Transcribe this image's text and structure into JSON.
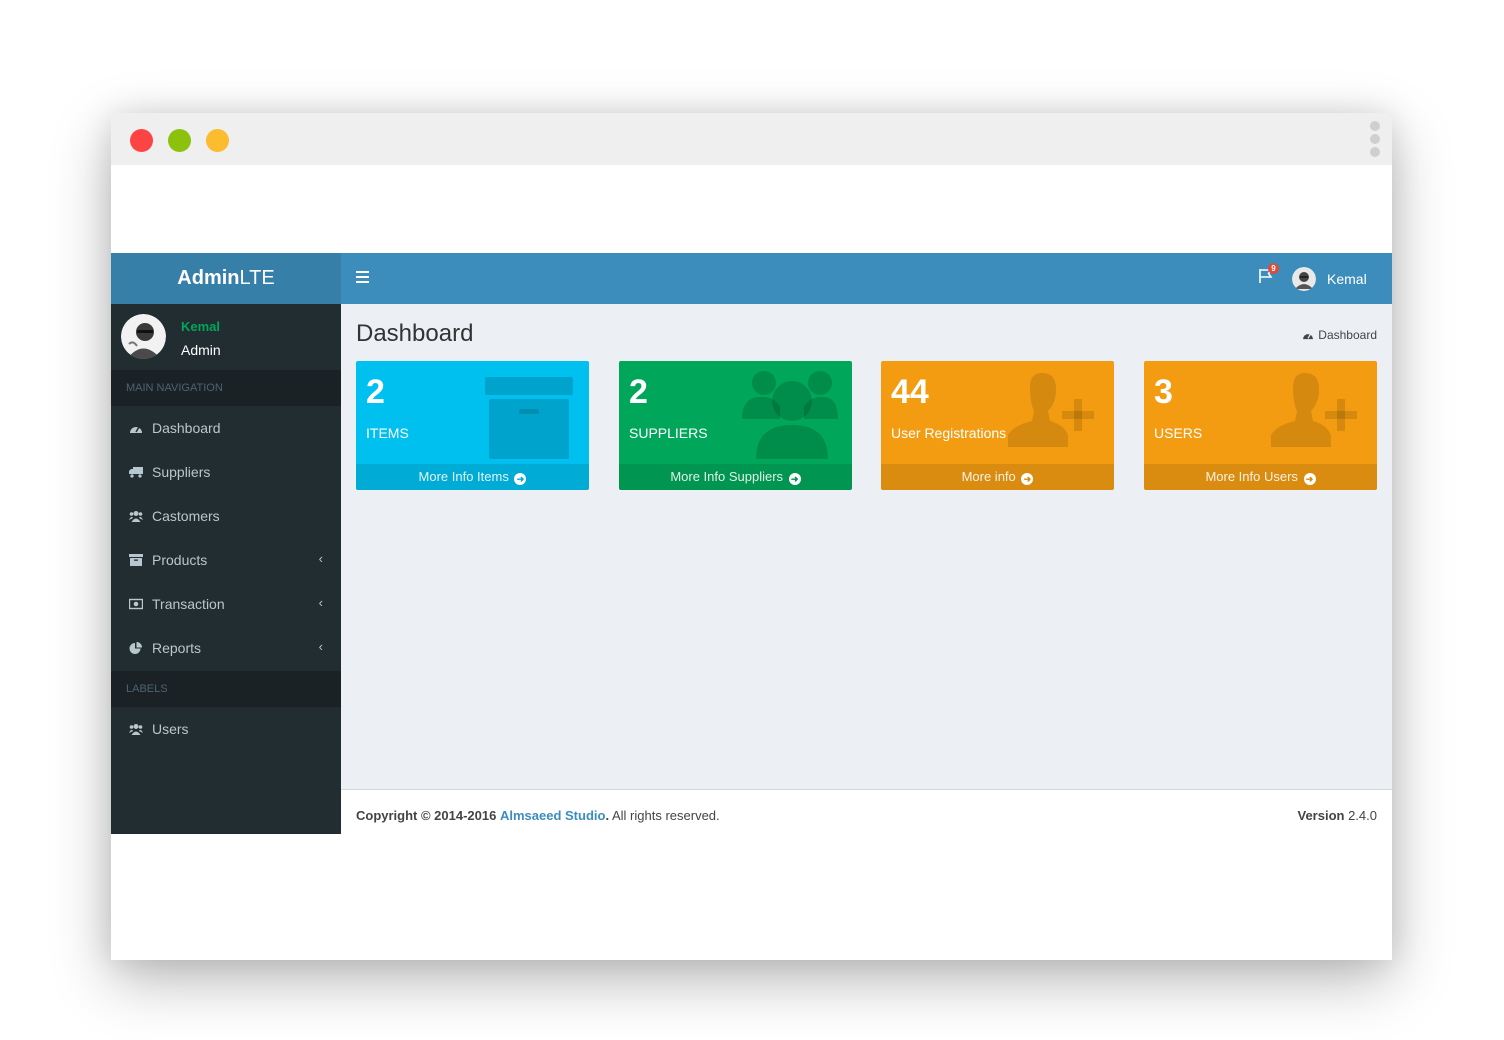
{
  "header": {
    "logo_bold": "Admin",
    "logo_light": "LTE",
    "notifications_count": "9",
    "user_name": "Kemal"
  },
  "sidebar": {
    "user": {
      "name": "Kemal",
      "role": "Admin"
    },
    "nav_header": "MAIN NAVIGATION",
    "items": [
      {
        "label": "Dashboard",
        "icon": "dashboard-icon"
      },
      {
        "label": "Suppliers",
        "icon": "truck-icon"
      },
      {
        "label": "Castomers",
        "icon": "users-icon"
      },
      {
        "label": "Products",
        "icon": "archive-icon"
      },
      {
        "label": "Transaction",
        "icon": "money-icon"
      },
      {
        "label": "Reports",
        "icon": "pie-chart-icon"
      }
    ],
    "labels_header": "LABELS",
    "label_items": [
      {
        "label": "Users",
        "icon": "users-icon"
      }
    ]
  },
  "content": {
    "title": "Dashboard",
    "breadcrumb": "Dashboard",
    "boxes": [
      {
        "number": "2",
        "caption": "ITEMS",
        "link": "More Info Items",
        "color": "#00c0ef",
        "icon": "archive-icon"
      },
      {
        "number": "2",
        "caption": "SUPPLIERS",
        "link": "More Info Suppliers",
        "color": "#00a65a",
        "icon": "users-icon"
      },
      {
        "number": "44",
        "caption": "User Registrations",
        "link": "More info",
        "color": "#f39c12",
        "icon": "user-plus-icon"
      },
      {
        "number": "3",
        "caption": "USERS",
        "link": "More Info Users",
        "color": "#f39c12",
        "icon": "user-plus-icon"
      }
    ]
  },
  "footer": {
    "copyright": "Copyright © 2014-2016",
    "company": "Almsaeed Studio",
    "rights": "All rights reserved.",
    "version_label": "Version",
    "version": "2.4.0"
  },
  "colors": {
    "header": "#3c8dbc",
    "logo": "#367fa9",
    "sidebar": "#222d32",
    "aqua": "#00c0ef",
    "green": "#00a65a",
    "orange": "#f39c12"
  }
}
